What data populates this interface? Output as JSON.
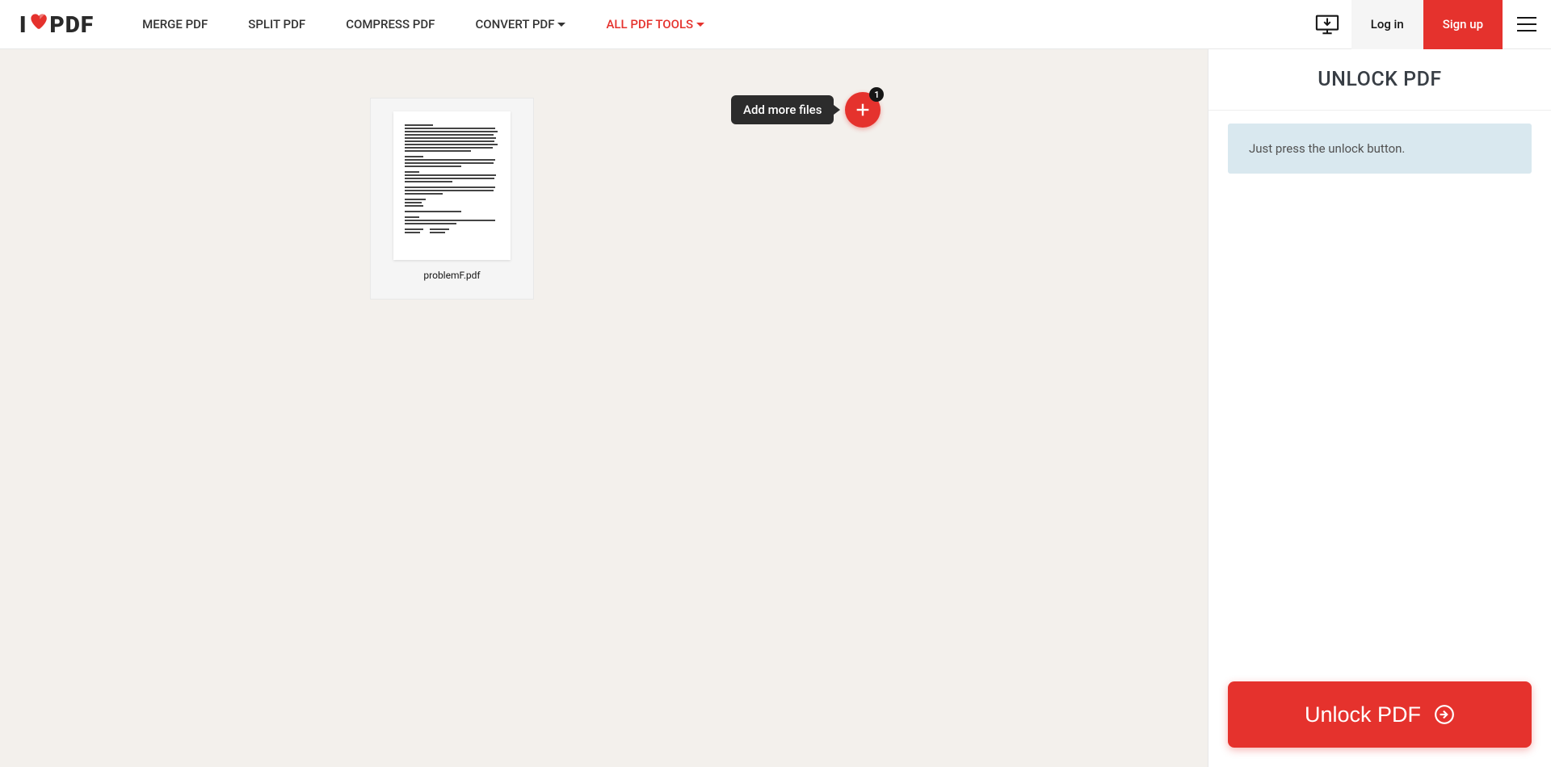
{
  "header": {
    "logo_left": "I",
    "logo_right": "PDF",
    "nav": {
      "merge": "MERGE PDF",
      "split": "SPLIT PDF",
      "compress": "COMPRESS PDF",
      "convert": "CONVERT PDF",
      "all": "ALL PDF TOOLS"
    },
    "login": "Log in",
    "signup": "Sign up"
  },
  "canvas": {
    "file_name": "problemF.pdf",
    "tooltip": "Add more files",
    "badge": "1"
  },
  "sidebar": {
    "title": "UNLOCK PDF",
    "info": "Just press the unlock button.",
    "action": "Unlock PDF"
  }
}
